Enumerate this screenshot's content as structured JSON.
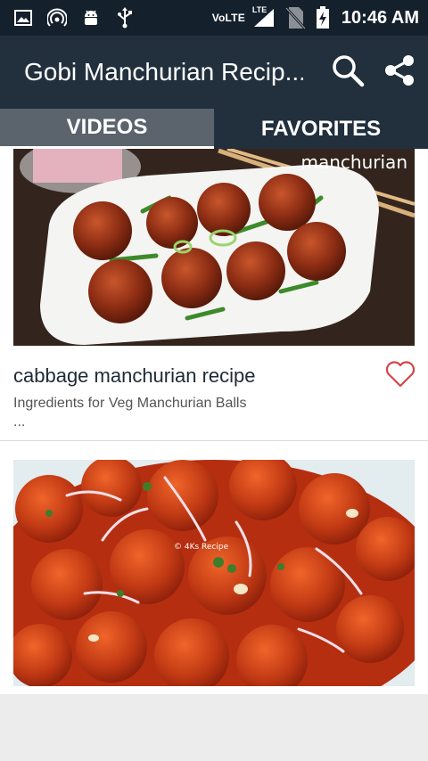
{
  "status_bar": {
    "network_label": "VoLTE",
    "lte_label": "LTE",
    "time": "10:46 AM",
    "icons": [
      "image-icon",
      "wifi-hotspot-icon",
      "android-icon",
      "usb-icon",
      "signal-icon",
      "no-sim-icon",
      "battery-charging-icon"
    ]
  },
  "app_bar": {
    "title": "Gobi Manchurian Recip...",
    "actions": [
      "search-icon",
      "share-icon"
    ]
  },
  "tabs": [
    {
      "label": "VIDEOS",
      "selected": true
    },
    {
      "label": "FAVORITES",
      "selected": false
    }
  ],
  "videos": [
    {
      "thumbnail_text": "manchurian",
      "title": "cabbage manchurian recipe",
      "description": "Ingredients for Veg Manchurian Balls",
      "description_more": "...",
      "favorite_icon": "heart-outline-icon"
    },
    {
      "thumbnail_text": "© 4Ks Recipe"
    }
  ],
  "colors": {
    "status_bar": "#15202d",
    "app_bar": "#22303e",
    "tab_selected": "#5b646c",
    "heart": "#d6454a"
  }
}
